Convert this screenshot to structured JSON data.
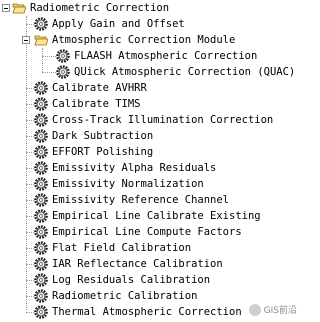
{
  "tree": {
    "root": {
      "label": "Radiometric Correction",
      "expanded": true,
      "icon": "folder-open-icon"
    },
    "items": [
      {
        "label": "Apply Gain and Offset",
        "icon": "gear-icon"
      },
      {
        "label": "Atmospheric Correction Module",
        "icon": "folder-open-icon",
        "expanded": true,
        "children": [
          {
            "label": "FLAASH Atmospheric Correction",
            "icon": "gear-icon"
          },
          {
            "label": "QUick Atmospheric Correction (QUAC)",
            "icon": "gear-icon"
          }
        ]
      },
      {
        "label": "Calibrate AVHRR",
        "icon": "gear-icon"
      },
      {
        "label": "Calibrate TIMS",
        "icon": "gear-icon"
      },
      {
        "label": "Cross-Track Illumination Correction",
        "icon": "gear-icon"
      },
      {
        "label": "Dark Subtraction",
        "icon": "gear-icon"
      },
      {
        "label": "EFFORT Polishing",
        "icon": "gear-icon"
      },
      {
        "label": "Emissivity Alpha Residuals",
        "icon": "gear-icon"
      },
      {
        "label": "Emissivity Normalization",
        "icon": "gear-icon"
      },
      {
        "label": "Emissivity Reference Channel",
        "icon": "gear-icon"
      },
      {
        "label": "Empirical Line Calibrate Existing",
        "icon": "gear-icon"
      },
      {
        "label": "Empirical Line Compute Factors",
        "icon": "gear-icon"
      },
      {
        "label": "Flat Field Calibration",
        "icon": "gear-icon"
      },
      {
        "label": "IAR Reflectance Calibration",
        "icon": "gear-icon"
      },
      {
        "label": "Log Residuals Calibration",
        "icon": "gear-icon"
      },
      {
        "label": "Radiometric Calibration",
        "icon": "gear-icon"
      },
      {
        "label": "Thermal Atmospheric Correction",
        "icon": "gear-icon"
      }
    ]
  },
  "watermark": {
    "text": "GIS前沿"
  }
}
